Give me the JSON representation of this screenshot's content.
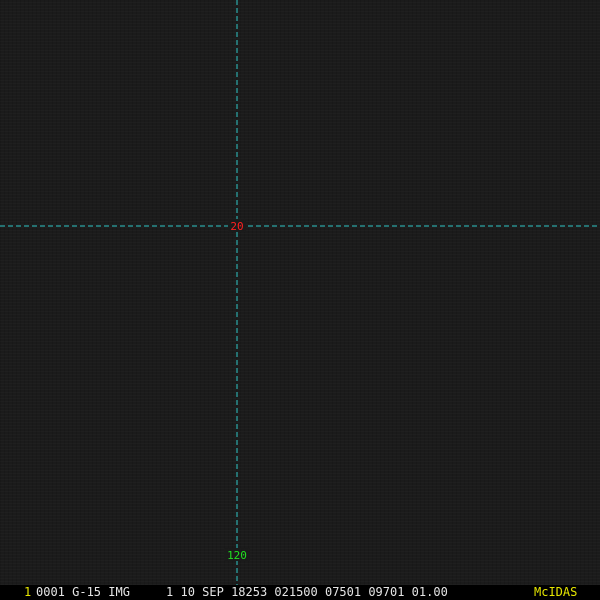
{
  "colors": {
    "background": "#1b1b1b",
    "grid_line": "#2fc7c7",
    "latitude_label": "#ff2020",
    "longitude_label": "#20e020",
    "status_text": "#e6e6e6",
    "frame_number": "#e6e600",
    "brand": "#e6e600"
  },
  "map": {
    "latitude_label": "20",
    "longitude_label": "120"
  },
  "status_bar": {
    "frame_number": "1",
    "info": "0001 G-15 IMG     1 10 SEP 18253 021500 07501 09701 01.00",
    "brand": "McIDAS"
  }
}
